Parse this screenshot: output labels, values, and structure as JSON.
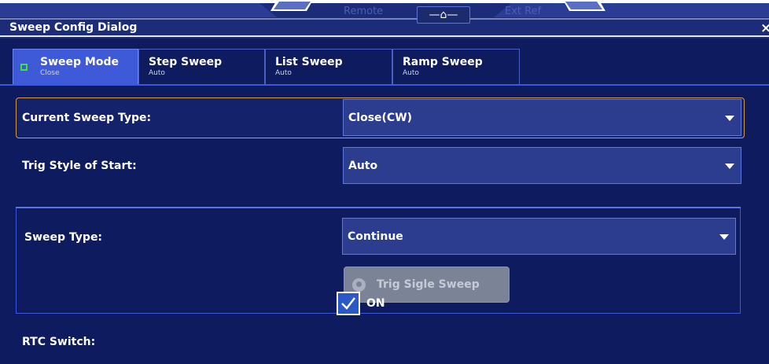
{
  "status_bar": {
    "remote_label": "Remote",
    "ext_ref_label": "Ext Ref",
    "home_icon": "home-icon"
  },
  "dialog": {
    "title": "Sweep Config Dialog",
    "close_label": "×"
  },
  "tabs": [
    {
      "label": "Sweep Mode",
      "sub": "Close",
      "active": true
    },
    {
      "label": "Step Sweep",
      "sub": "Auto",
      "active": false
    },
    {
      "label": "List Sweep",
      "sub": "Auto",
      "active": false
    },
    {
      "label": "Ramp Sweep",
      "sub": "Auto",
      "active": false
    }
  ],
  "fields": {
    "current_sweep_type": {
      "label": "Current Sweep Type:",
      "value": "Close(CW)"
    },
    "trig_style": {
      "label": "Trig Style of Start:",
      "value": "Auto"
    },
    "sweep_type": {
      "label": "Sweep Type:",
      "value": "Continue"
    },
    "trig_single_sweep": {
      "label": "Trig Sigle Sweep",
      "enabled": false
    },
    "rtc_switch": {
      "label": "RTC Switch:",
      "checked": true,
      "value_label": "ON"
    }
  },
  "colors": {
    "dialog_bg": "#0e1b5e",
    "accent": "#3f5ad8",
    "focus_border": "#d99a46",
    "active_tab_indicator": "#3ee33e"
  }
}
